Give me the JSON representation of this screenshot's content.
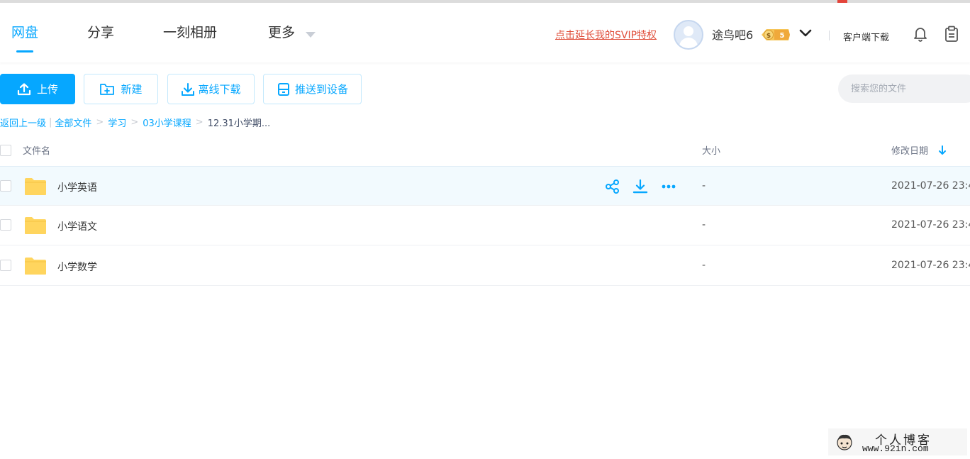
{
  "nav": {
    "tabs": [
      {
        "label": "网盘"
      },
      {
        "label": "分享"
      },
      {
        "label": "一刻相册"
      },
      {
        "label": "更多"
      }
    ],
    "svip_link": "点击延长我的SVIP特权",
    "username": "途鸟吧6",
    "client_download": "客户端下载"
  },
  "toolbar": {
    "upload": "上传",
    "new": "新建",
    "offline_download": "离线下载",
    "push_to_device": "推送到设备",
    "search_placeholder": "搜索您的文件"
  },
  "breadcrumb": {
    "back": "返回上一级",
    "all_files": "全部文件",
    "items": [
      "学习",
      "03小学课程"
    ],
    "current": "12.31小学期..."
  },
  "table": {
    "headers": {
      "name": "文件名",
      "size": "大小",
      "modified": "修改日期"
    },
    "rows": [
      {
        "name": "小学英语",
        "size": "-",
        "modified": "2021-07-26 23:4"
      },
      {
        "name": "小学语文",
        "size": "-",
        "modified": "2021-07-26 23:4"
      },
      {
        "name": "小学数学",
        "size": "-",
        "modified": "2021-07-26 23:4"
      }
    ]
  },
  "watermark": {
    "title": "个人博客",
    "url": "www.92in.com"
  },
  "colors": {
    "accent": "#06a7ff",
    "svip_link": "#e04f3b",
    "folder": "#ffd55e",
    "hover_row": "#f2fafe"
  }
}
